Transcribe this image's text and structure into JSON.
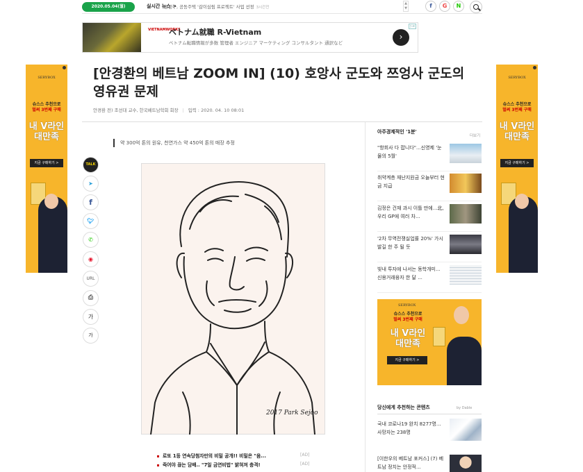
{
  "topbar": {
    "date": "2020.05.04(월)",
    "realtime_label": "실시간 뉴스 >",
    "ticker_text": "양천구, 공동주택 '감이심림 프로젝트' 사업 선정",
    "ticker_ago": "3시간전",
    "share_icons": [
      "facebook-icon",
      "google-icon",
      "naver-icon"
    ]
  },
  "banner": {
    "logo": "VIETNAMWORKS",
    "title": "ベトナム就職 R-Vietnam",
    "subtitle": "ベトナム転職情報が多数 管理者 エンジニア マーケティング コンサルタント 通訳など",
    "go": "›"
  },
  "article": {
    "headline": "[안경환의 베트남 ZOOM IN] (10) 호앙사 군도와 쯔엉사 군도의 영유권 문제",
    "byline": "안경환 전) 조선대 교수, 한국베트남학회 회장",
    "date": "입력 : 2020. 04. 10 08:01",
    "subhead": "약 300억 톤의 원유, 천연가스 약 450억 톤의 매장 추정",
    "signature": "2017 Park Sejoo"
  },
  "share": {
    "talk": "TALK",
    "url": "URL",
    "print": "⎙",
    "font_up": "가",
    "font_down": "가"
  },
  "related": [
    {
      "text": "로또 1등 연속당첨자만의 비밀 공개!! 비밀은 \"음...",
      "ad": "[AD]"
    },
    {
      "text": "죽어야 끊는 담배.. \"7일 금연비법\" 밝혀져 충격!",
      "ad": "[AD]"
    }
  ],
  "sidebar": {
    "title": "아주경제적인 '1분'",
    "more": "더보기",
    "items": [
      {
        "text": "\"항회사 다 팝니다\"...신영제 '눈물의 5월'"
      },
      {
        "text": "취약계층 재난지원금 오늘부터 현금 지급"
      },
      {
        "text": "김정은 건재 과시 이틀 만에...北, 우리 GP에 여러 차..."
      },
      {
        "text": "'2차 무역전쟁실업률 20%' 가시발길 한 주 될 듯"
      },
      {
        "text": "빚내 투자에 나서는 동학개미... 신용거래융자 한 달 ..."
      }
    ],
    "recommend_title": "당신에게 추천하는 콘텐츠",
    "recommend_by": "by Dable",
    "recommend": [
      {
        "text": "국내 코로나19 완치 8277명... 사망자는 238명"
      },
      {
        "text": "[이한우의 베트남 포커스] (7) 베트남 정치는 안정적..."
      }
    ]
  },
  "ads": {
    "brand": "SERYBOX",
    "promo_line1": "슈스스 추천으로",
    "promo_line2": "벌써 3번째 구매",
    "big_line1": "내 V라인",
    "big_line2": "대만족",
    "buy": "지금 구매하기 >"
  }
}
